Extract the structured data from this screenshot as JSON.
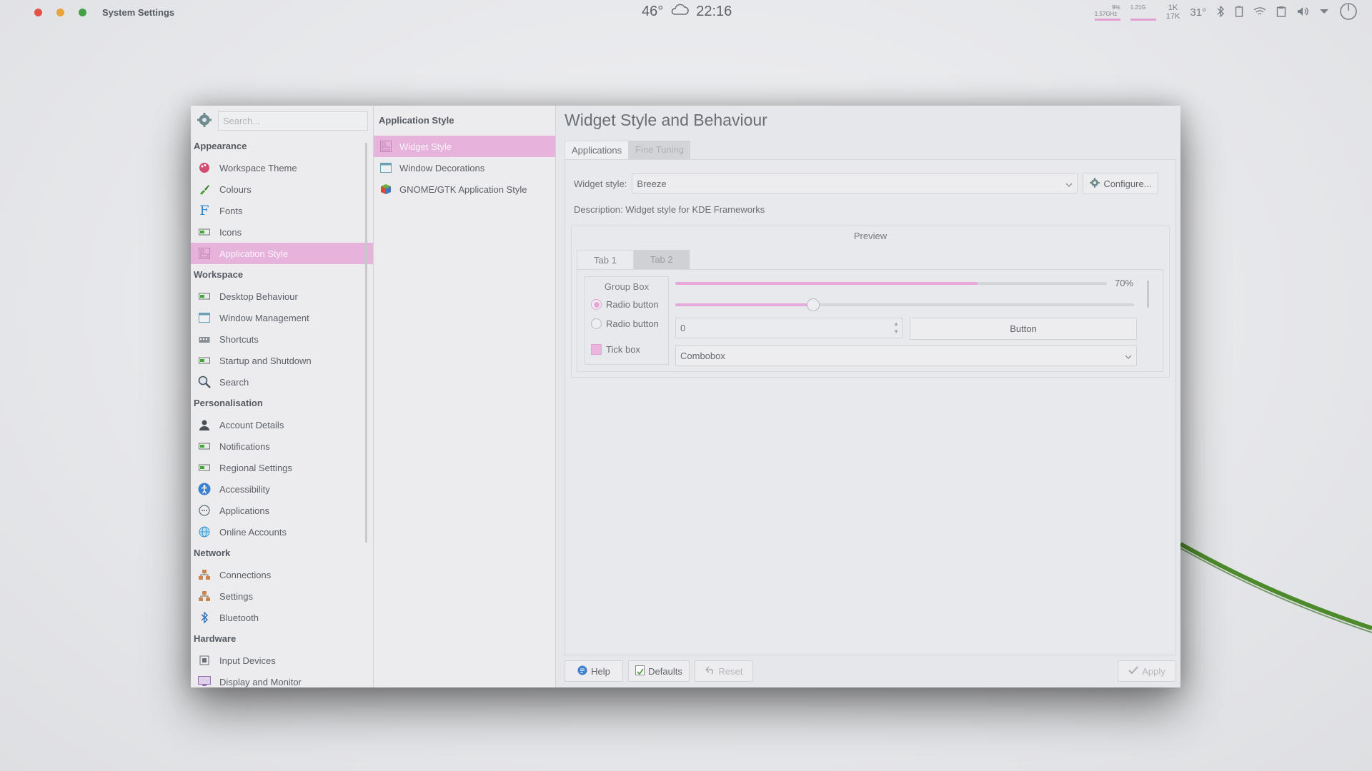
{
  "top_panel": {
    "window_title": "System Settings",
    "temperature": "46°",
    "clock": "22:16",
    "cpu_freq": "1.57GHz",
    "cpu_pct": "9%",
    "mem": "1.21G",
    "net_down": "1K",
    "net_up": "17K",
    "cpu_temp": "31°",
    "colors": {
      "close": "#e0524a",
      "minimize": "#e8a33a",
      "maximize": "#43a047"
    }
  },
  "sidebar": {
    "search_placeholder": "Search...",
    "categories": [
      {
        "title": "Appearance",
        "items": [
          {
            "label": "Workspace Theme",
            "icon": "palette-icon"
          },
          {
            "label": "Colours",
            "icon": "color-brush-icon"
          },
          {
            "label": "Fonts",
            "icon": "font-icon"
          },
          {
            "label": "Icons",
            "icon": "icons-icon"
          },
          {
            "label": "Application Style",
            "icon": "app-style-icon",
            "selected": true
          }
        ]
      },
      {
        "title": "Workspace",
        "items": [
          {
            "label": "Desktop Behaviour",
            "icon": "desktop-icon"
          },
          {
            "label": "Window Management",
            "icon": "window-icon"
          },
          {
            "label": "Shortcuts",
            "icon": "keyboard-icon"
          },
          {
            "label": "Startup and Shutdown",
            "icon": "power-icon"
          },
          {
            "label": "Search",
            "icon": "search-icon"
          }
        ]
      },
      {
        "title": "Personalisation",
        "items": [
          {
            "label": "Account Details",
            "icon": "user-icon"
          },
          {
            "label": "Notifications",
            "icon": "notification-icon"
          },
          {
            "label": "Regional Settings",
            "icon": "region-icon"
          },
          {
            "label": "Accessibility",
            "icon": "accessibility-icon"
          },
          {
            "label": "Applications",
            "icon": "applications-icon"
          },
          {
            "label": "Online Accounts",
            "icon": "globe-icon"
          }
        ]
      },
      {
        "title": "Network",
        "items": [
          {
            "label": "Connections",
            "icon": "network-icon"
          },
          {
            "label": "Settings",
            "icon": "network-settings-icon"
          },
          {
            "label": "Bluetooth",
            "icon": "bluetooth-icon"
          }
        ]
      },
      {
        "title": "Hardware",
        "items": [
          {
            "label": "Input Devices",
            "icon": "input-devices-icon"
          },
          {
            "label": "Display and Monitor",
            "icon": "monitor-icon"
          }
        ]
      }
    ]
  },
  "midpanel": {
    "title": "Application Style",
    "items": [
      {
        "label": "Widget Style",
        "selected": true
      },
      {
        "label": "Window Decorations"
      },
      {
        "label": "GNOME/GTK Application Style"
      }
    ]
  },
  "content": {
    "title": "Widget Style and Behaviour",
    "tabs": [
      "Applications",
      "Fine Tuning"
    ],
    "widget_style_label": "Widget style:",
    "widget_style_value": "Breeze",
    "configure_label": "Configure...",
    "description": "Description: Widget style for KDE Frameworks",
    "preview": {
      "title": "Preview",
      "tabs": [
        "Tab 1",
        "Tab 2"
      ],
      "group_box": "Group Box",
      "radio1": "Radio button",
      "radio2": "Radio button",
      "tick": "Tick box",
      "progress": 0.7,
      "progress_label": "70%",
      "slider": 0.3,
      "spin_value": "0",
      "button": "Button",
      "combobox": "Combobox"
    },
    "footer": {
      "help": "Help",
      "defaults": "Defaults",
      "reset": "Reset",
      "apply": "Apply"
    }
  },
  "accent": "#e6b3dd"
}
